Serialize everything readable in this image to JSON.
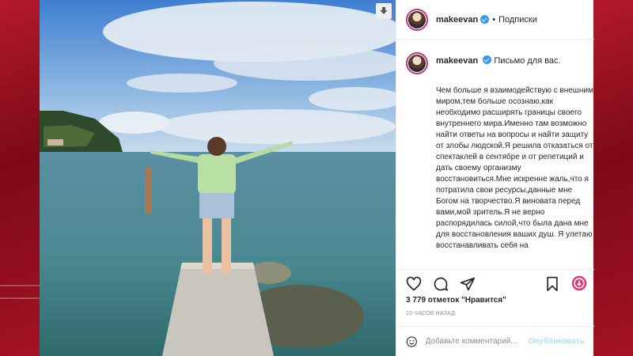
{
  "post": {
    "username": "makeevan",
    "follow_separator": "•",
    "follow_label": "Подписки",
    "caption_title": "Письмо для вас.",
    "caption_text": "Чем больше я взаимодействую с внешним миром,тем больше осознаю,как необходимо расширять границы своего внутреннего мира.Именно там возможно найти ответы на вопросы и найти защиту от злобы людской.Я решила отказаться от спектаклей в сентябре и от репетиций и дать своему организму восстановиться.Мне искренне жаль,что я потратила свои ресурсы,данные мне Богом на творчество.Я виновата перед вами,мой зритель.Я не верно распорядилась силой,что была дана мне для восстановления ваших душ. Я улетаю восстанавливать себя на",
    "likes_text": "3 779 отметок \"Нравится\"",
    "time_text": "10 ЧАСОВ НАЗАД",
    "comment_placeholder": "Добавьте комментарий...",
    "publish_label": "Опубликовать"
  },
  "icons": {
    "download": "download-icon",
    "verified": "verified-badge-icon",
    "like": "heart-icon",
    "comment": "comment-icon",
    "share": "share-icon",
    "save": "bookmark-icon",
    "boost": "boost-icon",
    "emoji": "emoji-icon"
  },
  "colors": {
    "verified": "#3897f0",
    "link_disabled": "#b2dffc",
    "muted": "#8e8e8e",
    "backdrop": "#8e0d1c"
  }
}
